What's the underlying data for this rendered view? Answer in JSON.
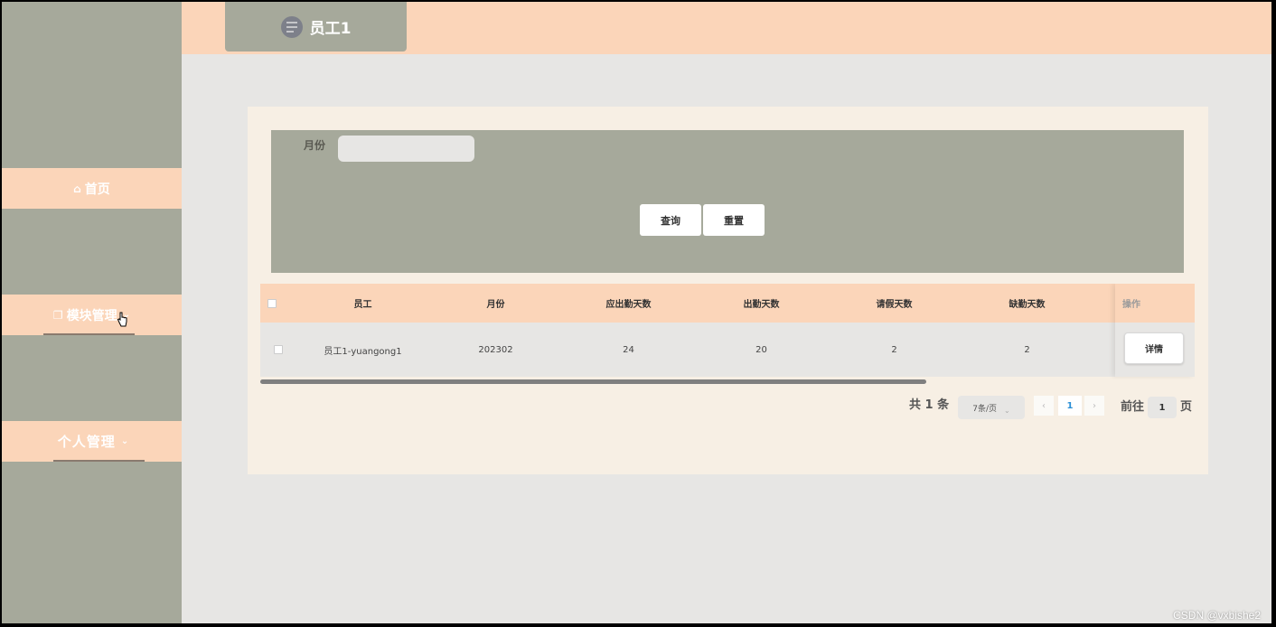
{
  "header": {
    "title": "员工1"
  },
  "sidebar": {
    "items": [
      {
        "label": "首页",
        "icon": "home-icon"
      },
      {
        "label": "模块管理",
        "icon": "copy-icon"
      },
      {
        "label": "个人管理"
      }
    ]
  },
  "search": {
    "month_label": "月份",
    "month_value": "",
    "month_placeholder": "",
    "query_label": "查询",
    "reset_label": "重置"
  },
  "table": {
    "columns": [
      "员工",
      "月份",
      "应出勤天数",
      "出勤天数",
      "请假天数",
      "缺勤天数",
      "操作"
    ],
    "rows": [
      {
        "employee": "员工1-yuangong1",
        "month": "202302",
        "due_days": "24",
        "attended_days": "20",
        "leave_days": "2",
        "absent_days": "2",
        "action": "详情"
      }
    ]
  },
  "pagination": {
    "total": "共 1 条",
    "page_size": "7条/页",
    "current_page": "1",
    "goto_label": "前往",
    "goto_value": "1",
    "page_suffix": "页"
  },
  "watermark": "CSDN @vxbishe2",
  "colors": {
    "sidebar_bg": "#a6a99b",
    "accent_peach": "#fbd5b9",
    "content_bg": "#e7e6e4",
    "card_bg": "#f7efe4",
    "link_blue": "#2a8fd6"
  }
}
